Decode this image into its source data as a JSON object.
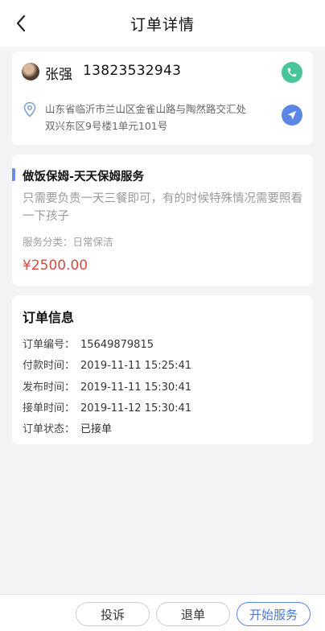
{
  "header": {
    "title": "订单详情",
    "back_icon": "chevron-left-icon"
  },
  "contact": {
    "name": "张强",
    "phone": "13823532943",
    "address_line1": "山东省临沂市兰山区金雀山路与陶然路交汇处",
    "address_line2": "双兴东区9号楼1单元101号",
    "phone_button_color": "#48c59a",
    "nav_button_color": "#5b86e5"
  },
  "service": {
    "title": "做饭保姆-天天保姆服务",
    "description": "只需要负责一天三餐即可，有的时候特殊情况需要照看一下孩子",
    "category_label": "服务分类：",
    "category_value": "日常保洁",
    "price": "¥2500.00",
    "price_color": "#d64a3d"
  },
  "order_info": {
    "title": "订单信息",
    "rows": [
      {
        "label": "订单编号：",
        "value": "15649879815"
      },
      {
        "label": "付款时间：",
        "value": "2019-11-11  15:25:41"
      },
      {
        "label": "发布时间：",
        "value": "2019-11-11  15:30:41"
      },
      {
        "label": "接单时间：",
        "value": "2019-11-12  15:30:41"
      },
      {
        "label": "订单状态：",
        "value": "已接单"
      }
    ]
  },
  "actions": {
    "complain": "投诉",
    "cancel": "退单",
    "start": "开始服务",
    "accent_color": "#5b86e5"
  }
}
